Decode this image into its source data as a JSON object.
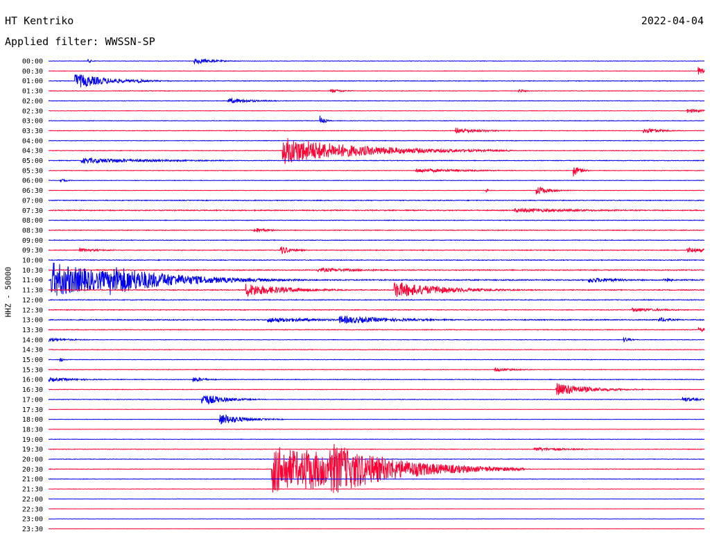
{
  "header": {
    "station": "HT Kentriko",
    "filter": "Applied filter: WWSSN-SP",
    "date": "2022-04-04"
  },
  "chart_data": {
    "type": "line",
    "title": "HT Kentriko",
    "subtitle": "Applied filter: WWSSN-SP",
    "ylabel": "HHZ - 50000",
    "date": "2022-04-04",
    "x_unit": "minutes within 30-min row",
    "x_range": [
      0,
      30
    ],
    "colors": {
      "even_rows": "#0000ee",
      "odd_rows": "#ff0033"
    },
    "rows": [
      "00:00",
      "00:30",
      "01:00",
      "01:30",
      "02:00",
      "02:30",
      "03:00",
      "03:30",
      "04:00",
      "04:30",
      "05:00",
      "05:30",
      "06:00",
      "06:30",
      "07:00",
      "07:30",
      "08:00",
      "08:30",
      "09:00",
      "09:30",
      "10:00",
      "10:30",
      "11:00",
      "11:30",
      "12:00",
      "12:30",
      "13:00",
      "13:30",
      "14:00",
      "14:30",
      "15:00",
      "15:30",
      "16:00",
      "16:30",
      "17:00",
      "17:30",
      "18:00",
      "18:30",
      "19:00",
      "19:30",
      "20:00",
      "20:30",
      "21:00",
      "21:30",
      "22:00",
      "22:30",
      "23:00",
      "23:30"
    ],
    "noise_level": [
      0.6,
      0.6,
      0.8,
      0.7,
      0.7,
      0.6,
      0.7,
      0.8,
      0.7,
      0.8,
      0.9,
      0.7,
      0.6,
      0.6,
      1.0,
      1.3,
      0.8,
      0.9,
      0.8,
      1.0,
      1.0,
      1.2,
      1.5,
      1.1,
      1.0,
      0.9,
      1.3,
      0.9,
      0.7,
      0.7,
      0.7,
      0.7,
      0.8,
      0.7,
      0.7,
      0.5,
      0.5,
      0.5,
      0.6,
      0.8,
      0.7,
      0.8,
      0.6,
      0.5,
      0.4,
      0.4,
      0.4,
      0.3
    ],
    "events": [
      {
        "row": 0,
        "t": 6.65,
        "amp": 5,
        "dur": 0.8
      },
      {
        "row": 0,
        "t": 1.8,
        "amp": 3,
        "dur": 0.2
      },
      {
        "row": 1,
        "t": 29.7,
        "amp": 6,
        "dur": 0.5
      },
      {
        "row": 2,
        "t": 1.2,
        "amp": 11,
        "dur": 1.5
      },
      {
        "row": 2,
        "t": 4.1,
        "amp": 4,
        "dur": 0.3
      },
      {
        "row": 3,
        "t": 12.9,
        "amp": 3,
        "dur": 0.6
      },
      {
        "row": 3,
        "t": 21.5,
        "amp": 3,
        "dur": 0.3
      },
      {
        "row": 4,
        "t": 8.2,
        "amp": 4,
        "dur": 1.2
      },
      {
        "row": 5,
        "t": 29.2,
        "amp": 3,
        "dur": 1.0
      },
      {
        "row": 6,
        "t": 12.4,
        "amp": 8,
        "dur": 0.2
      },
      {
        "row": 7,
        "t": 18.6,
        "amp": 5,
        "dur": 1.1
      },
      {
        "row": 7,
        "t": 27.2,
        "amp": 5,
        "dur": 0.7
      },
      {
        "row": 9,
        "t": 10.7,
        "amp": 20,
        "dur": 3.5
      },
      {
        "row": 10,
        "t": 1.5,
        "amp": 4,
        "dur": 3.5
      },
      {
        "row": 11,
        "t": 24.0,
        "amp": 9,
        "dur": 0.3
      },
      {
        "row": 11,
        "t": 16.8,
        "amp": 3,
        "dur": 2.5
      },
      {
        "row": 12,
        "t": 0.5,
        "amp": 3,
        "dur": 0.3
      },
      {
        "row": 13,
        "t": 22.3,
        "amp": 7,
        "dur": 0.6
      },
      {
        "row": 13,
        "t": 20.0,
        "amp": 4,
        "dur": 0.1
      },
      {
        "row": 15,
        "t": 21.3,
        "amp": 3,
        "dur": 4.0
      },
      {
        "row": 17,
        "t": 9.4,
        "amp": 4,
        "dur": 0.6
      },
      {
        "row": 19,
        "t": 1.4,
        "amp": 3,
        "dur": 1.0
      },
      {
        "row": 19,
        "t": 10.6,
        "amp": 7,
        "dur": 0.5
      },
      {
        "row": 19,
        "t": 29.2,
        "amp": 4,
        "dur": 1.0
      },
      {
        "row": 21,
        "t": 12.3,
        "amp": 3,
        "dur": 2.5
      },
      {
        "row": 22,
        "t": 0.1,
        "amp": 26,
        "dur": 3.4
      },
      {
        "row": 22,
        "t": 2.8,
        "amp": 22,
        "dur": 3.0
      },
      {
        "row": 22,
        "t": 24.7,
        "amp": 4,
        "dur": 1.5
      },
      {
        "row": 22,
        "t": 28.1,
        "amp": 6,
        "dur": 0.3
      },
      {
        "row": 23,
        "t": 9.0,
        "amp": 10,
        "dur": 1.8
      },
      {
        "row": 23,
        "t": 11.0,
        "amp": 4,
        "dur": 0.8
      },
      {
        "row": 23,
        "t": 15.8,
        "amp": 12,
        "dur": 2.2
      },
      {
        "row": 23,
        "t": 17.7,
        "amp": 8,
        "dur": 0.6
      },
      {
        "row": 25,
        "t": 26.7,
        "amp": 3,
        "dur": 1.5
      },
      {
        "row": 26,
        "t": 10.0,
        "amp": 4,
        "dur": 2.5
      },
      {
        "row": 26,
        "t": 13.3,
        "amp": 6,
        "dur": 2.5
      },
      {
        "row": 26,
        "t": 27.9,
        "amp": 4,
        "dur": 0.6
      },
      {
        "row": 27,
        "t": 29.7,
        "amp": 4,
        "dur": 0.5
      },
      {
        "row": 28,
        "t": 0.0,
        "amp": 3,
        "dur": 1.0
      },
      {
        "row": 28,
        "t": 26.3,
        "amp": 4,
        "dur": 0.3
      },
      {
        "row": 30,
        "t": 0.5,
        "amp": 4,
        "dur": 0.2
      },
      {
        "row": 31,
        "t": 20.4,
        "amp": 3,
        "dur": 1.0
      },
      {
        "row": 32,
        "t": 0.0,
        "amp": 3,
        "dur": 1.5
      },
      {
        "row": 32,
        "t": 6.6,
        "amp": 4,
        "dur": 0.6
      },
      {
        "row": 33,
        "t": 23.2,
        "amp": 10,
        "dur": 1.5
      },
      {
        "row": 34,
        "t": 7.0,
        "amp": 9,
        "dur": 1.0
      },
      {
        "row": 34,
        "t": 29.0,
        "amp": 4,
        "dur": 0.6
      },
      {
        "row": 36,
        "t": 7.8,
        "amp": 9,
        "dur": 1.0
      },
      {
        "row": 39,
        "t": 22.2,
        "amp": 3,
        "dur": 1.5
      },
      {
        "row": 41,
        "t": 10.2,
        "amp": 36,
        "dur": 3.5
      },
      {
        "row": 41,
        "t": 11.7,
        "amp": 32,
        "dur": 3.0
      },
      {
        "row": 41,
        "t": 12.8,
        "amp": 40,
        "dur": 3.0
      }
    ]
  }
}
